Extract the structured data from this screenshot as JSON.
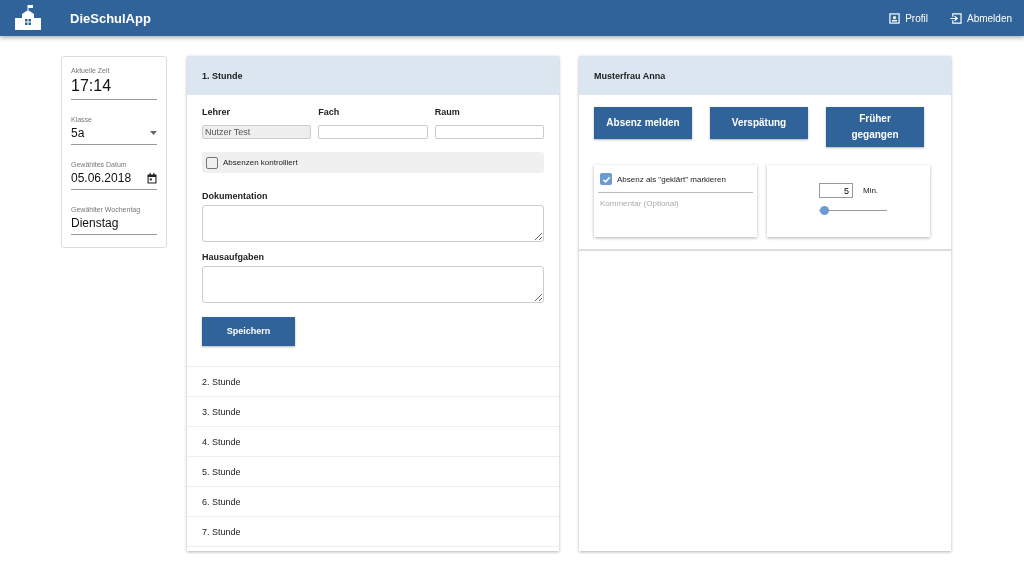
{
  "app": {
    "title": "DieSchulApp"
  },
  "nav": [
    {
      "label": "Profil",
      "kind": "profile"
    },
    {
      "label": "Abmelden",
      "kind": "logout"
    }
  ],
  "info_fields": [
    {
      "label": "Aktuelle Zeit",
      "value": "17:14",
      "kind": "clock"
    },
    {
      "label": "Klasse",
      "value": "5a",
      "kind": "select"
    },
    {
      "label": "Gewähltes Datum",
      "value": "05.06.2018",
      "kind": "date"
    },
    {
      "label": "Gewählter Wochentag",
      "value": "Dienstag",
      "kind": "text"
    }
  ],
  "lessons": [
    {
      "title": "1. Stunde",
      "expanded": true
    },
    {
      "title": "2. Stunde",
      "expanded": false
    },
    {
      "title": "3. Stunde",
      "expanded": false
    },
    {
      "title": "4. Stunde",
      "expanded": false
    },
    {
      "title": "5. Stunde",
      "expanded": false
    },
    {
      "title": "6. Stunde",
      "expanded": false
    },
    {
      "title": "7. Stunde",
      "expanded": false
    }
  ],
  "lesson_form": {
    "fields": [
      {
        "label": "Lehrer",
        "value": "Nutzer Test",
        "disabled": true
      },
      {
        "label": "Fach",
        "disabled": false
      },
      {
        "label": "Raum",
        "disabled": false
      }
    ],
    "absences_checked": {
      "label": "Absenzen kontrolliert",
      "checked": false
    },
    "textareas": [
      {
        "label": "Dokumentation"
      },
      {
        "label": "Hausaufgaben"
      }
    ],
    "save_button": "Speichern"
  },
  "student": {
    "name": "Musterfrau Anna",
    "actions": [
      "Absenz melden",
      "Verspätung",
      "Früher gegangen"
    ],
    "clarified": {
      "label": "Absenz als \"geklärt\" markieren",
      "checked": true
    },
    "comment": {
      "placeholder": "Kommentar (Optional)"
    },
    "minutes": {
      "value": "5",
      "unit": "Min.",
      "level": 0.08
    }
  }
}
